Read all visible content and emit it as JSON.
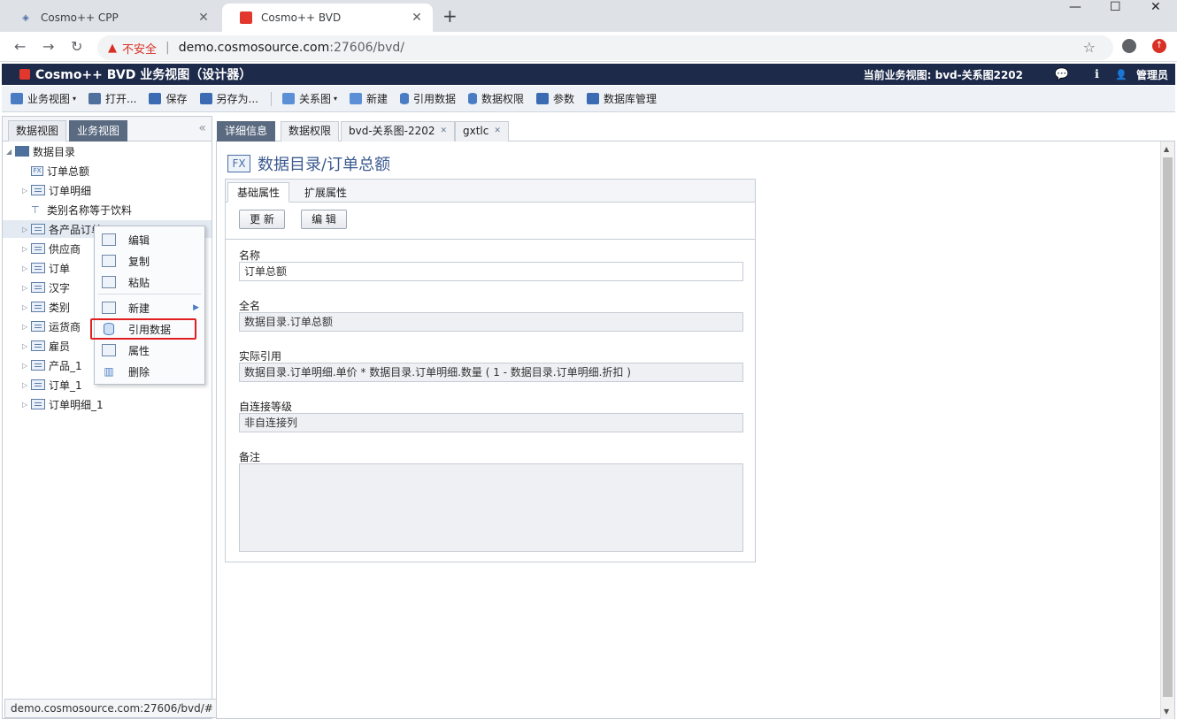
{
  "browser": {
    "tabs": [
      {
        "title": "Cosmo++ CPP",
        "close": "✕"
      },
      {
        "title": "Cosmo++ BVD",
        "close": "✕"
      }
    ],
    "new_tab": "+",
    "window_controls": {
      "minimize": "—",
      "maximize": "☐",
      "close": "✕"
    },
    "nav": {
      "back": "←",
      "forward": "→",
      "reload": "↻"
    },
    "address": {
      "warning_icon": "▲",
      "insecure_label": "不安全",
      "separator": "|",
      "host": "demo.cosmosource.com",
      "path": ":27606/bvd/"
    },
    "star": "☆",
    "update_badge": "↑"
  },
  "app": {
    "title": "Cosmo++ BVD 业务视图（设计器）",
    "current_view": "当前业务视图: bvd-关系图2202",
    "chat_icon": "💬",
    "info_icon": "ℹ",
    "user_icon": "👤",
    "user": "管理员",
    "accent": "#1d2a4a"
  },
  "toolbar": {
    "business_view": "业务视图",
    "open": "打开...",
    "save": "保存",
    "save_as": "另存为...",
    "relation_diagram": "关系图",
    "new": "新建",
    "ref_data": "引用数据",
    "data_permission": "数据权限",
    "params": "参数",
    "db_manage": "数据库管理",
    "dropdown": "▾"
  },
  "left": {
    "tabs": [
      "数据视图",
      "业务视图"
    ],
    "collapse": "«",
    "tree": {
      "root": "数据目录",
      "root_arrow": "◢",
      "items": [
        {
          "label": "订单总额",
          "type": "fx",
          "arrow": ""
        },
        {
          "label": "订单明细",
          "type": "table",
          "arrow": "▷"
        },
        {
          "label": "类别名称等于饮料",
          "type": "filter",
          "arrow": ""
        },
        {
          "label": "各产品订单",
          "type": "table",
          "arrow": "▷"
        },
        {
          "label": "供应商",
          "type": "table",
          "arrow": "▷"
        },
        {
          "label": "订单",
          "type": "table",
          "arrow": "▷"
        },
        {
          "label": "汉字",
          "type": "table",
          "arrow": "▷"
        },
        {
          "label": "类别",
          "type": "table",
          "arrow": "▷"
        },
        {
          "label": "运货商",
          "type": "table",
          "arrow": "▷"
        },
        {
          "label": "雇员",
          "type": "table",
          "arrow": "▷"
        },
        {
          "label": "产品_1",
          "type": "table",
          "arrow": "▷"
        },
        {
          "label": "订单_1",
          "type": "table",
          "arrow": "▷"
        },
        {
          "label": "订单明细_1",
          "type": "table",
          "arrow": "▷"
        }
      ]
    },
    "status_url": "demo.cosmosource.com:27606/bvd/#"
  },
  "context_menu": {
    "items": [
      {
        "label": "编辑"
      },
      {
        "label": "复制"
      },
      {
        "label": "粘贴"
      },
      {
        "label": "新建",
        "submenu": "▶"
      },
      {
        "label": "引用数据"
      },
      {
        "label": "属性"
      },
      {
        "label": "删除"
      }
    ],
    "highlight_color": "#e02020"
  },
  "right": {
    "tabs": [
      {
        "label": "详细信息"
      },
      {
        "label": "数据权限"
      },
      {
        "label": "bvd-关系图-2202",
        "close": "✕"
      },
      {
        "label": "gxtlc",
        "close": "✕"
      }
    ],
    "page_icon": "FX",
    "page_title": "数据目录/订单总额",
    "form": {
      "tabs": [
        "基础属性",
        "扩展属性"
      ],
      "update_button": "更 新",
      "edit_button": "编 辑",
      "fields": {
        "name_label": "名称",
        "name_value": "订单总额",
        "fullname_label": "全名",
        "fullname_value": "数据目录.订单总额",
        "ref_label": "实际引用",
        "ref_value": "数据目录.订单明细.单价 * 数据目录.订单明细.数量 ( 1 - 数据目录.订单明细.折扣 )",
        "self_join_label": "自连接等级",
        "self_join_value": "非自连接列",
        "note_label": "备注",
        "note_value": ""
      }
    },
    "scroll_up": "▲",
    "scroll_down": "▼"
  }
}
